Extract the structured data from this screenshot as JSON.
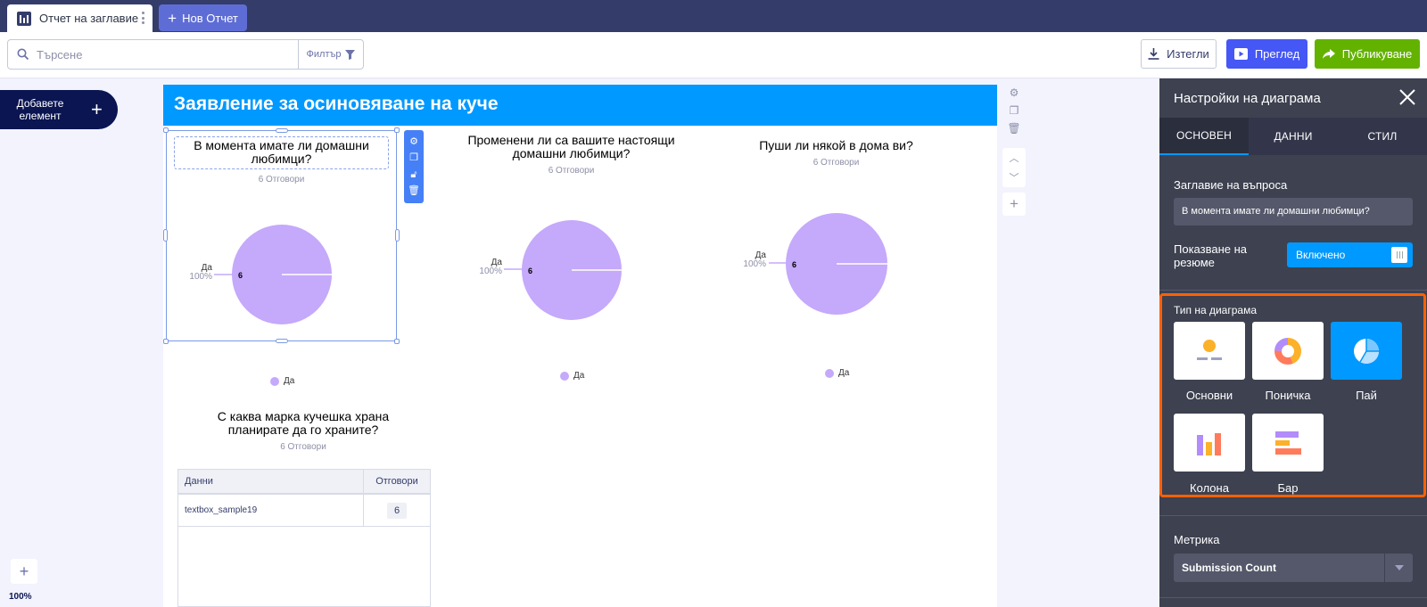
{
  "tabs": {
    "active_label": "Отчет на заглавие",
    "new_label": "Нов Отчет"
  },
  "toolbar": {
    "search_placeholder": "Търсене",
    "filter_label": "Филтър",
    "download_label": "Изтегли",
    "preview_label": "Преглед",
    "publish_label": "Публикуване"
  },
  "left_rail": {
    "add_element_label": "Добавете елемент",
    "zoom": "100%"
  },
  "report": {
    "title": "Заявление за осиновяване на куче",
    "widgets": [
      {
        "title": "В момента имате ли домашни любимци?",
        "answers": "6 Отговори",
        "slice_label": "Да",
        "slice_pct": "100%",
        "value": "6",
        "legend": "Да",
        "share": 1.0
      },
      {
        "title": "Променени ли са вашите настоящи домашни любимци?",
        "answers": "6 Отговори",
        "slice_label": "Да",
        "slice_pct": "100%",
        "value": "6",
        "legend": "Да",
        "share": 1.0
      },
      {
        "title": "Пуши ли някой в дома ви?",
        "answers": "6 Отговори",
        "slice_label": "Да",
        "slice_pct": "100%",
        "value": "6",
        "legend": "Да",
        "share": 1.0
      }
    ],
    "table_widget": {
      "title": "С каква марка кучешка храна планирате да го храните?",
      "answers": "6 Отговори",
      "col_data": "Данни",
      "col_answers": "Отговори",
      "rows": [
        {
          "name": "textbox_sample19",
          "count": "6"
        }
      ]
    },
    "pie_color": "#c5a9fb"
  },
  "panel": {
    "title": "Настройки на диаграма",
    "tabs": [
      "ОСНОВЕН",
      "ДАННИ",
      "СТИЛ"
    ],
    "active_tab": "ОСНОВЕН",
    "question_title_label": "Заглавие на въпроса",
    "question_title_value": "В момента имате ли домашни любимци?",
    "summary_label": "Показване на резюме",
    "summary_value": "Включено",
    "chart_type_label": "Тип на диаграма",
    "chart_types": [
      "Основни",
      "Поничка",
      "Пай",
      "Колона",
      "Бар"
    ],
    "selected_chart_type": "Пай",
    "metric_label": "Метрика",
    "metric_value": "Submission Count"
  },
  "colors": {
    "accent": "#0099ff",
    "highlight_border": "#ff6100",
    "publish": "#64b200",
    "preview": "#4557f5",
    "navy": "#0a1551"
  }
}
